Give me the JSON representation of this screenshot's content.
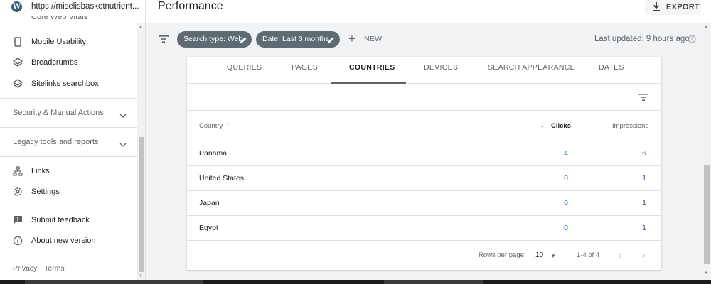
{
  "sidebar": {
    "site_url": "https://miselisbasketnutrient...",
    "partial_item": "Core Web Vitals",
    "items": [
      {
        "label": "Mobile Usability",
        "icon": "phone-icon"
      },
      {
        "label": "Breadcrumbs",
        "icon": "layers-icon"
      },
      {
        "label": "Sitelinks searchbox",
        "icon": "layers-icon"
      }
    ],
    "sections": [
      {
        "label": "Security & Manual Actions"
      },
      {
        "label": "Legacy tools and reports"
      }
    ],
    "bottom_items": [
      {
        "label": "Links",
        "icon": "links-icon"
      },
      {
        "label": "Settings",
        "icon": "gear-icon"
      },
      {
        "label": "Submit feedback",
        "icon": "feedback-icon"
      },
      {
        "label": "About new version",
        "icon": "info-icon"
      }
    ],
    "footer": {
      "privacy": "Privacy",
      "terms": "Terms"
    }
  },
  "header": {
    "title": "Performance",
    "export_label": "EXPORT"
  },
  "filter_bar": {
    "chips": [
      {
        "label": "Search type: Web"
      },
      {
        "label": "Date: Last 3 months"
      }
    ],
    "new_label": "NEW",
    "last_updated": "Last updated: 9 hours ago"
  },
  "tabs": [
    "QUERIES",
    "PAGES",
    "COUNTRIES",
    "DEVICES",
    "SEARCH APPEARANCE",
    "DATES"
  ],
  "active_tab": "COUNTRIES",
  "table": {
    "headers": {
      "country": "Country",
      "clicks": "Clicks",
      "impressions": "Impressions"
    },
    "rows": [
      {
        "country": "Panama",
        "clicks": "4",
        "impressions": "6"
      },
      {
        "country": "United States",
        "clicks": "0",
        "impressions": "1"
      },
      {
        "country": "Japan",
        "clicks": "0",
        "impressions": "1"
      },
      {
        "country": "Egypt",
        "clicks": "0",
        "impressions": "1"
      }
    ]
  },
  "pagination": {
    "rows_per_page_label": "Rows per page:",
    "rows_per_page": "10",
    "range": "1-4 of 4"
  },
  "colors": {
    "chip_bg": "#5f6b73",
    "clicks": "#1a73e8",
    "impressions": "#5e35b1",
    "panel_bg": "#f1f3f4"
  }
}
